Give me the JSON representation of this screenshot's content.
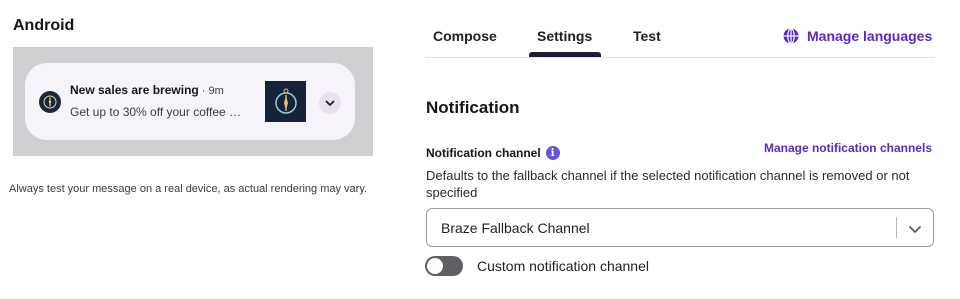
{
  "preview": {
    "platform_title": "Android",
    "notification": {
      "title": "New sales are brewing",
      "time": " · 9m",
      "body": "Get up to 30% off your coffee …"
    },
    "note": "Always test your message on a real device, as actual rendering may vary."
  },
  "tabs": [
    {
      "label": "Compose"
    },
    {
      "label": "Settings",
      "active": true
    },
    {
      "label": "Test"
    }
  ],
  "manage_languages_label": "Manage languages",
  "section": {
    "title": "Notification",
    "channel_label": "Notification channel",
    "manage_channels_label": "Manage notification channels",
    "channel_help": "Defaults to the fallback channel if the selected notification channel is removed or not specified",
    "channel_selected": "Braze Fallback Channel",
    "custom_channel_label": "Custom notification channel",
    "custom_channel_enabled": false
  },
  "colors": {
    "accent": "#5c26c8",
    "info": "#6558d8",
    "preview_bg": "#cfcfd1",
    "card_bg": "#f7f3fb"
  },
  "icons": [
    "app-compass-icon",
    "chevron-down-icon",
    "globe-icon",
    "info-icon",
    "select-chevron-icon"
  ]
}
